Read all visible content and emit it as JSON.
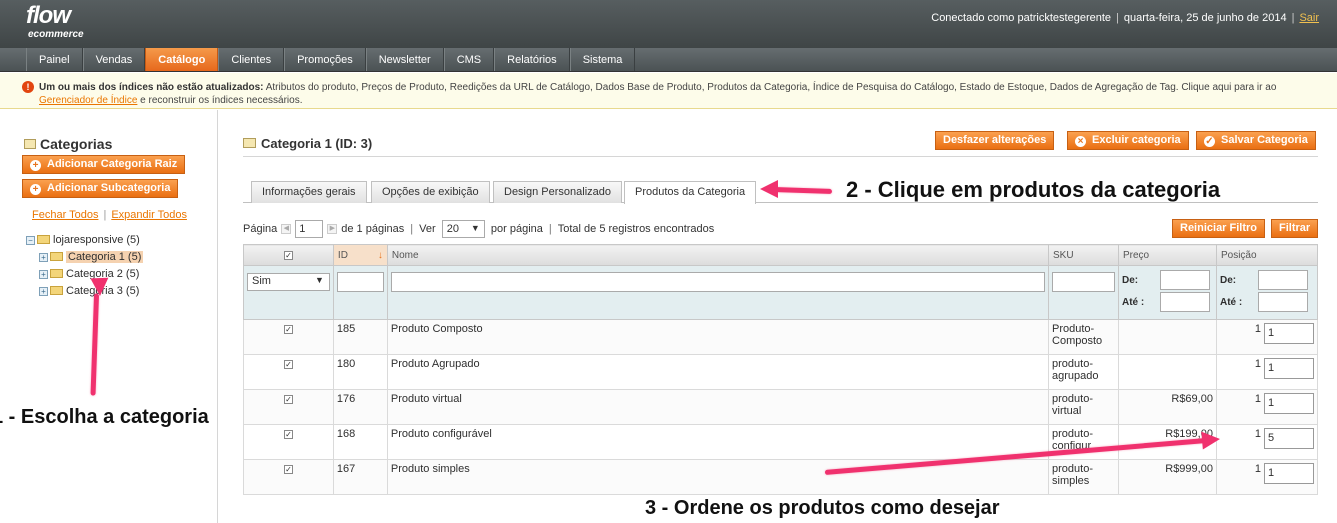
{
  "logo": {
    "line1": "flow",
    "line2": "ecommerce"
  },
  "header": {
    "user_text": "Conectado como patricktestegerente",
    "date_text": "quarta-feira, 25 de junho de 2014",
    "logout": "Sair"
  },
  "nav": {
    "items": [
      {
        "label": "Painel"
      },
      {
        "label": "Vendas"
      },
      {
        "label": "Catálogo"
      },
      {
        "label": "Clientes"
      },
      {
        "label": "Promoções"
      },
      {
        "label": "Newsletter"
      },
      {
        "label": "CMS"
      },
      {
        "label": "Relatórios"
      },
      {
        "label": "Sistema"
      }
    ],
    "active": "Catálogo"
  },
  "notice": {
    "bold": "Um ou mais dos índices não estão atualizados:",
    "text": " Atributos do produto, Preços de Produto, Reedições da URL de Catálogo, Dados Base de Produto, Produtos da Categoria, Índice de Pesquisa do Catálogo, Estado de Estoque, Dados de Agregação de Tag. Clique aqui para ir ao ",
    "link": "Gerenciador de Índice",
    "text2": " e reconstruir os índices necessários."
  },
  "sidebar": {
    "title": "Categorias",
    "add_root": "Adicionar Categoria Raiz",
    "add_sub": "Adicionar Subcategoria",
    "collapse_all": "Fechar Todos",
    "expand_all": "Expandir Todos",
    "tree": {
      "root": "lojaresponsive (5)",
      "children": [
        "Categoria 1 (5)",
        "Categoria 2 (5)",
        "Categoria 3 (5)"
      ]
    }
  },
  "main": {
    "title": "Categoria 1 (ID: 3)",
    "btn_reset": "Desfazer alterações",
    "btn_delete": "Excluir categoria",
    "btn_save": "Salvar Categoria",
    "tabs": [
      "Informações gerais",
      "Opções de exibição",
      "Design Personalizado",
      "Produtos da Categoria"
    ],
    "active_tab": "Produtos da Categoria"
  },
  "pager": {
    "page_label": "Página",
    "page_value": "1",
    "of_pages": "de 1 páginas",
    "view_label": "Ver",
    "per_page": "20",
    "per_page_label": "por página",
    "total": "Total de 5 registros encontrados",
    "reset_filter": "Reiniciar Filtro",
    "filter": "Filtrar"
  },
  "grid": {
    "headers": {
      "id": "ID",
      "name": "Nome",
      "sku": "SKU",
      "price": "Preço",
      "position": "Posição"
    },
    "filter": {
      "select": "Sim",
      "from": "De:",
      "to": "Até :"
    },
    "rows": [
      {
        "id": "185",
        "name": "Produto Composto",
        "sku1": "Produto-",
        "sku2": "Composto",
        "price": "",
        "pos": "1",
        "pos_input": "1"
      },
      {
        "id": "180",
        "name": "Produto Agrupado",
        "sku1": "produto-",
        "sku2": "agrupado",
        "price": "",
        "pos": "1",
        "pos_input": "1"
      },
      {
        "id": "176",
        "name": "Produto virtual",
        "sku1": "produto-",
        "sku2": "virtual",
        "price": "R$69,00",
        "pos": "1",
        "pos_input": "1"
      },
      {
        "id": "168",
        "name": "Produto configurável",
        "sku1": "produto-",
        "sku2": "configur",
        "price": "R$199,00",
        "pos": "1",
        "pos_input": "5"
      },
      {
        "id": "167",
        "name": "Produto simples",
        "sku1": "produto-",
        "sku2": "simples",
        "price": "R$999,00",
        "pos": "1",
        "pos_input": "1"
      }
    ]
  },
  "annotations": {
    "a1": "1 - Escolha a categoria",
    "a2": "2 - Clique em produtos da categoria",
    "a3": "3 - Ordene os produtos como desejar"
  },
  "colors": {
    "accent": "#ea6f12",
    "arrow": "#f0316e",
    "nav_bg": "#4b5254"
  }
}
